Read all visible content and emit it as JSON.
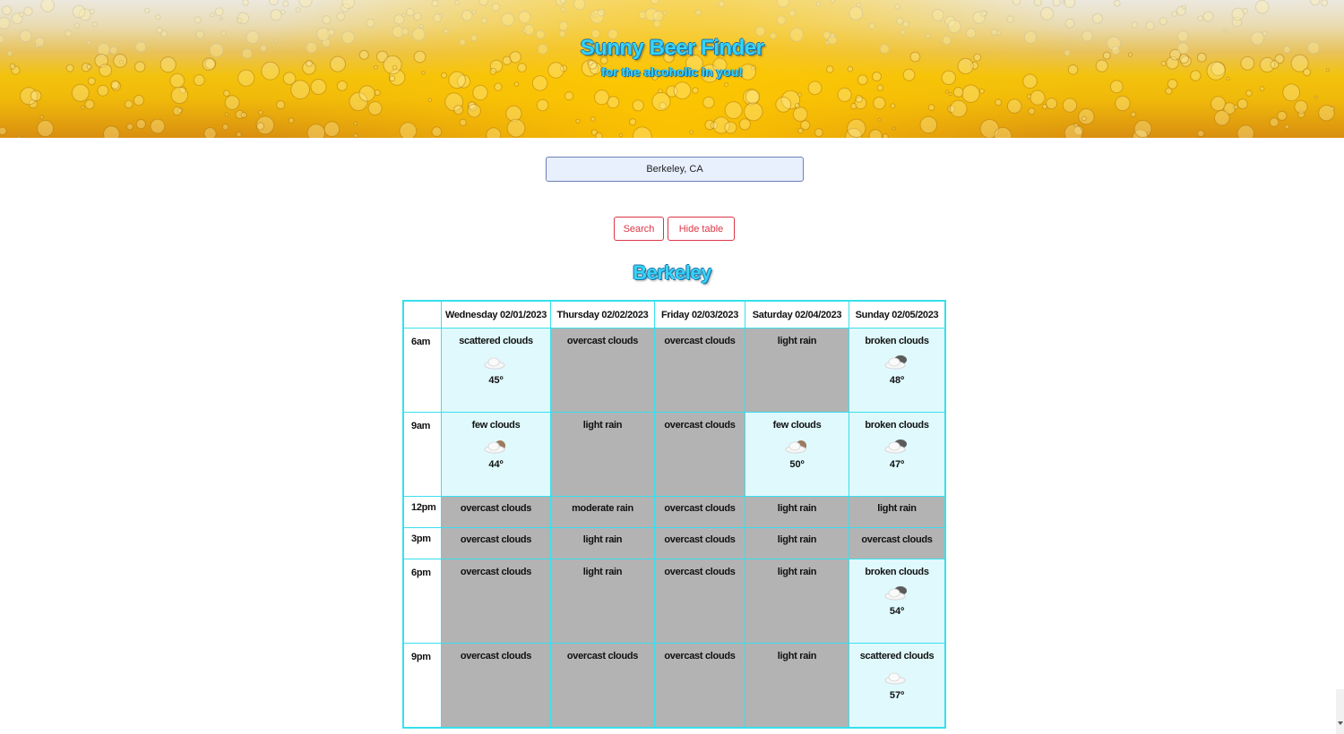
{
  "header": {
    "title": "Sunny Beer Finder",
    "subtitle": "for the alcoholic in you!"
  },
  "search": {
    "value": "Berkeley, CA",
    "search_label": "Search",
    "hide_label": "Hide table"
  },
  "city": "Berkeley",
  "colors": {
    "accent": "#37d4f5",
    "table_border": "#37e0ee",
    "sunny_bg": "#dff9fd",
    "cloudy_bg": "#b3b3b3",
    "button": "#dc3545"
  },
  "days": [
    "Wednesday 02/01/2023",
    "Thursday 02/02/2023",
    "Friday 02/03/2023",
    "Saturday 02/04/2023",
    "Sunday 02/05/2023"
  ],
  "rows": [
    {
      "time": "6am",
      "cells": [
        {
          "desc": "scattered clouds",
          "sunny": true,
          "icon": "cloud-icon",
          "temp": "45º"
        },
        {
          "desc": "overcast clouds",
          "sunny": false
        },
        {
          "desc": "overcast clouds",
          "sunny": false
        },
        {
          "desc": "light rain",
          "sunny": false
        },
        {
          "desc": "broken clouds",
          "sunny": true,
          "icon": "broken-clouds-icon",
          "temp": "48º"
        }
      ]
    },
    {
      "time": "9am",
      "cells": [
        {
          "desc": "few clouds",
          "sunny": true,
          "icon": "few-clouds-icon",
          "temp": "44º"
        },
        {
          "desc": "light rain",
          "sunny": false
        },
        {
          "desc": "overcast clouds",
          "sunny": false
        },
        {
          "desc": "few clouds",
          "sunny": true,
          "icon": "few-clouds-icon",
          "temp": "50º"
        },
        {
          "desc": "broken clouds",
          "sunny": true,
          "icon": "broken-clouds-icon",
          "temp": "47º"
        }
      ]
    },
    {
      "time": "12pm",
      "cells": [
        {
          "desc": "overcast clouds",
          "sunny": false
        },
        {
          "desc": "moderate rain",
          "sunny": false
        },
        {
          "desc": "overcast clouds",
          "sunny": false
        },
        {
          "desc": "light rain",
          "sunny": false
        },
        {
          "desc": "light rain",
          "sunny": false
        }
      ]
    },
    {
      "time": "3pm",
      "cells": [
        {
          "desc": "overcast clouds",
          "sunny": false
        },
        {
          "desc": "light rain",
          "sunny": false
        },
        {
          "desc": "overcast clouds",
          "sunny": false
        },
        {
          "desc": "light rain",
          "sunny": false
        },
        {
          "desc": "overcast clouds",
          "sunny": false
        }
      ]
    },
    {
      "time": "6pm",
      "cells": [
        {
          "desc": "overcast clouds",
          "sunny": false
        },
        {
          "desc": "light rain",
          "sunny": false
        },
        {
          "desc": "overcast clouds",
          "sunny": false
        },
        {
          "desc": "light rain",
          "sunny": false
        },
        {
          "desc": "broken clouds",
          "sunny": true,
          "icon": "broken-clouds-icon",
          "temp": "54º"
        }
      ]
    },
    {
      "time": "9pm",
      "cells": [
        {
          "desc": "overcast clouds",
          "sunny": false
        },
        {
          "desc": "overcast clouds",
          "sunny": false
        },
        {
          "desc": "overcast clouds",
          "sunny": false
        },
        {
          "desc": "light rain",
          "sunny": false
        },
        {
          "desc": "scattered clouds",
          "sunny": true,
          "icon": "cloud-icon",
          "temp": "57º"
        }
      ]
    }
  ]
}
